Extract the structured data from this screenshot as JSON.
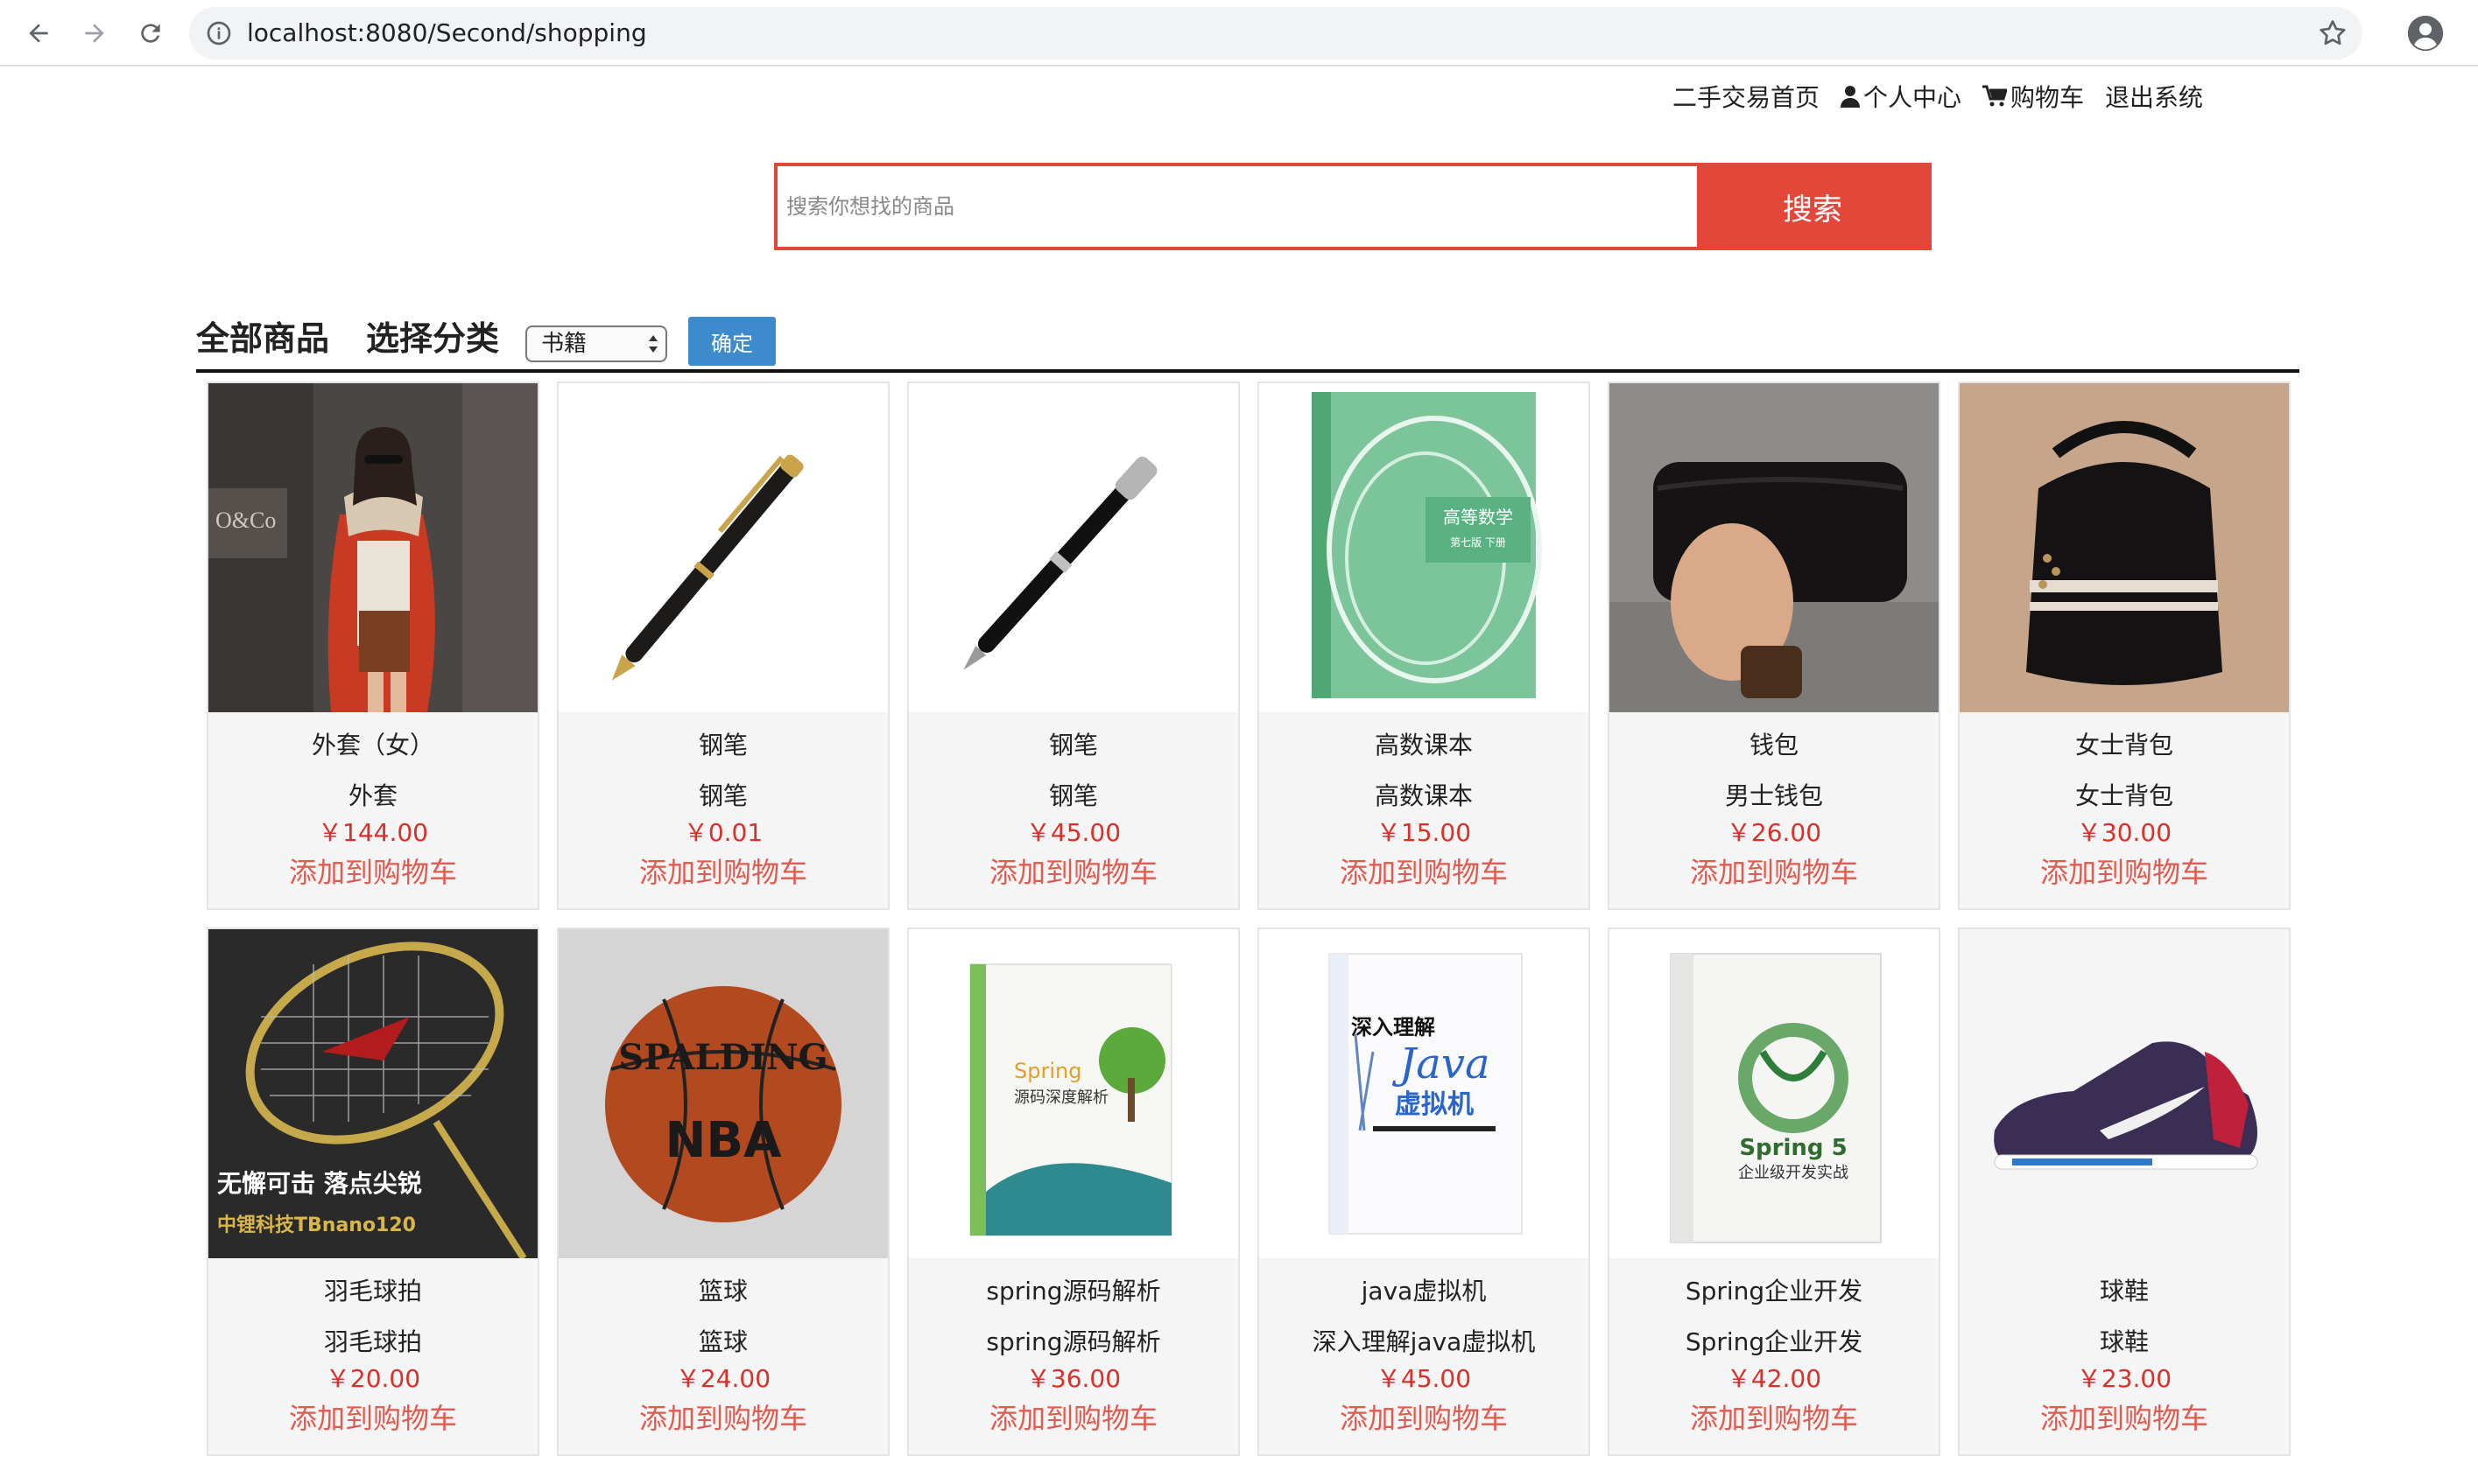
{
  "browser": {
    "url": "localhost:8080/Second/shopping",
    "icons": [
      "back-arrow-icon",
      "forward-arrow-icon",
      "reload-icon",
      "info-icon",
      "star-icon",
      "profile-icon"
    ]
  },
  "nav": {
    "home": "二手交易首页",
    "profile": "个人中心",
    "cart": "购物车",
    "logout": "退出系统"
  },
  "search": {
    "placeholder": "搜索你想找的商品",
    "button": "搜索"
  },
  "filter": {
    "title": "全部商品",
    "category_label": "选择分类",
    "selected": "书籍",
    "confirm": "确定"
  },
  "colors": {
    "accent": "#e2473a",
    "price": "#d9302a",
    "confirm_button": "#3d8bcd"
  },
  "add_to_cart": "添加到购物车",
  "products": [
    {
      "name": "外套（女）",
      "desc": "外套",
      "price": "￥144.00",
      "image": "coat"
    },
    {
      "name": "钢笔",
      "desc": "钢笔",
      "price": "￥0.01",
      "image": "pen-gold"
    },
    {
      "name": "钢笔",
      "desc": "钢笔",
      "price": "￥45.00",
      "image": "pen-silver"
    },
    {
      "name": "高数课本",
      "desc": "高数课本",
      "price": "￥15.00",
      "image": "math-book"
    },
    {
      "name": "钱包",
      "desc": "男士钱包",
      "price": "￥26.00",
      "image": "wallet"
    },
    {
      "name": "女士背包",
      "desc": "女士背包",
      "price": "￥30.00",
      "image": "backpack"
    },
    {
      "name": "羽毛球拍",
      "desc": "羽毛球拍",
      "price": "￥20.00",
      "image": "racket"
    },
    {
      "name": "篮球",
      "desc": "篮球",
      "price": "￥24.00",
      "image": "basketball"
    },
    {
      "name": "spring源码解析",
      "desc": "spring源码解析",
      "price": "￥36.00",
      "image": "spring-book"
    },
    {
      "name": "java虚拟机",
      "desc": "深入理解java虚拟机",
      "price": "￥45.00",
      "image": "jvm-book"
    },
    {
      "name": "Spring企业开发",
      "desc": "Spring企业开发",
      "price": "￥42.00",
      "image": "spring5-book"
    },
    {
      "name": "球鞋",
      "desc": "球鞋",
      "price": "￥23.00",
      "image": "sneaker"
    }
  ],
  "image_text": {
    "math_book": [
      "高等数学",
      "第七版 下册"
    ],
    "racket": [
      "无懈可击 落点尖锐",
      "中锂科技TBnano120"
    ],
    "basketball": [
      "SPALDING",
      "NBA"
    ],
    "spring_book": [
      "Spring",
      "源码深度解析"
    ],
    "jvm_book": [
      "深入理解",
      "Java",
      "虚拟机"
    ],
    "spring5_book": [
      "Spring 5",
      "企业级开发实战"
    ]
  }
}
